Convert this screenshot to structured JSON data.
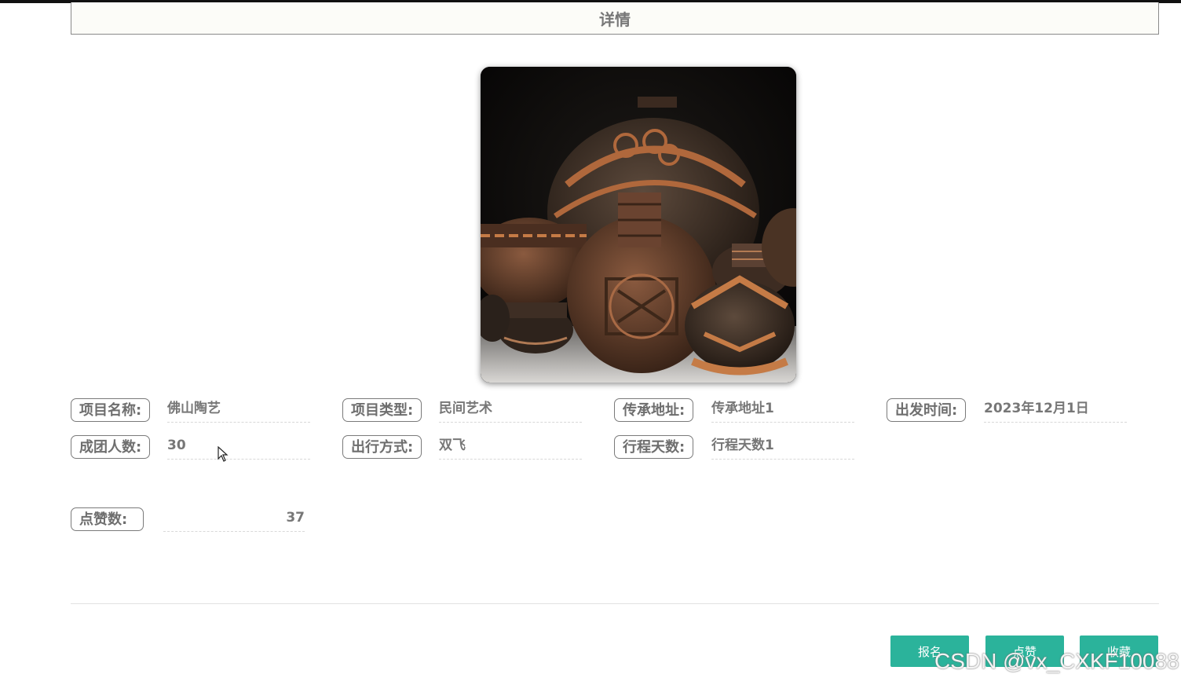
{
  "page": {
    "title": "详情"
  },
  "fields": {
    "row1": [
      {
        "label": "项目名称:",
        "value": "佛山陶艺"
      },
      {
        "label": "项目类型:",
        "value": "民间艺术"
      },
      {
        "label": "传承地址:",
        "value": "传承地址1"
      },
      {
        "label": "出发时间:",
        "value": "2023年12月1日"
      }
    ],
    "row2": [
      {
        "label": "成团人数:",
        "value": "30"
      },
      {
        "label": "出行方式:",
        "value": "双飞"
      },
      {
        "label": "行程天数:",
        "value": "行程天数1"
      }
    ],
    "likes": {
      "label": "点赞数:",
      "value": "37"
    }
  },
  "actions": {
    "signup_label": "报名",
    "like_label": "点赞",
    "favorite_label": "收藏"
  },
  "watermark": "CSDN @vx_CXKF10088",
  "colors": {
    "button": "#2bb39b",
    "label_border": "#7a7a7a"
  }
}
